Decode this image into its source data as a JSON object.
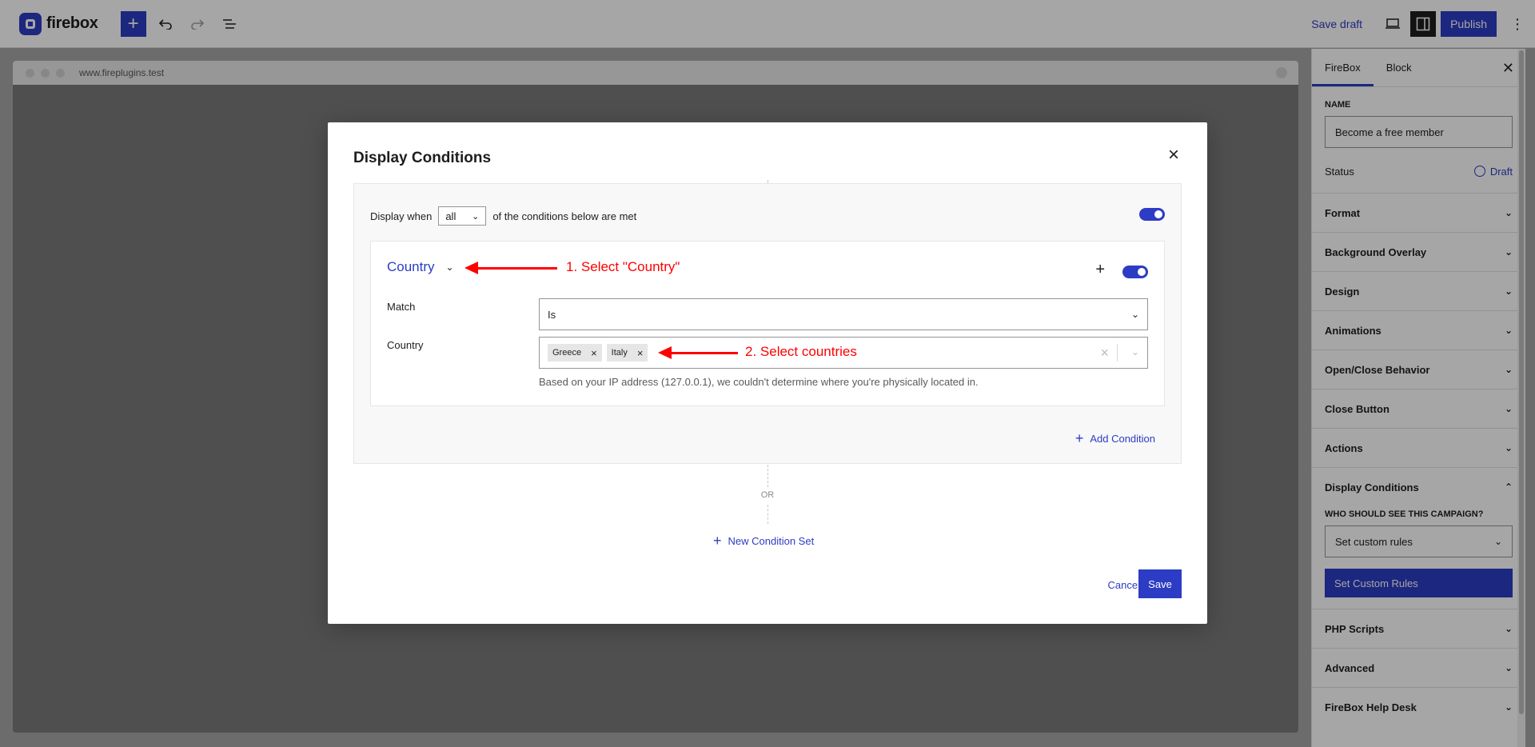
{
  "topbar": {
    "logo_text": "firebox",
    "add_icon": "plus-icon",
    "undo_icon": "undo-icon",
    "redo_icon": "redo-icon",
    "list_icon": "list-view-icon",
    "save_draft": "Save draft",
    "preview_icon": "laptop-icon",
    "settings_icon": "sidebar-toggle-icon",
    "publish": "Publish",
    "more_icon": "more-vertical-icon"
  },
  "canvas": {
    "url": "www.fireplugins.test"
  },
  "sidebar": {
    "tabs": [
      "FireBox",
      "Block"
    ],
    "name_label": "NAME",
    "name_value": "Become a free member",
    "status_label": "Status",
    "status_value": "Draft",
    "panels_top": [
      "Format",
      "Background Overlay",
      "Design",
      "Animations",
      "Open/Close Behavior",
      "Close Button",
      "Actions"
    ],
    "display_conditions": {
      "title": "Display Conditions",
      "who_label": "WHO SHOULD SEE THIS CAMPAIGN?",
      "select_value": "Set custom rules",
      "button": "Set Custom Rules"
    },
    "panels_bottom": [
      "PHP Scripts",
      "Advanced",
      "FireBox Help Desk"
    ]
  },
  "modal": {
    "title": "Display Conditions",
    "display_when": "Display when",
    "match_mode": "all",
    "display_when_suffix": "of the conditions below are met",
    "condition": {
      "type": "Country",
      "match_label": "Match",
      "match_value": "Is",
      "country_label": "Country",
      "countries": [
        "Greece",
        "Italy"
      ],
      "help": "Based on your IP address (127.0.0.1), we couldn't determine where you're physically located in."
    },
    "add_condition": "Add Condition",
    "or_label": "OR",
    "new_condition_set": "New Condition Set",
    "cancel": "Cancel",
    "save": "Save"
  },
  "annotations": {
    "step1": "1. Select \"Country\"",
    "step2": "2. Select countries"
  },
  "colors": {
    "accent": "#2c3cc4",
    "annotation": "#ff0000"
  }
}
